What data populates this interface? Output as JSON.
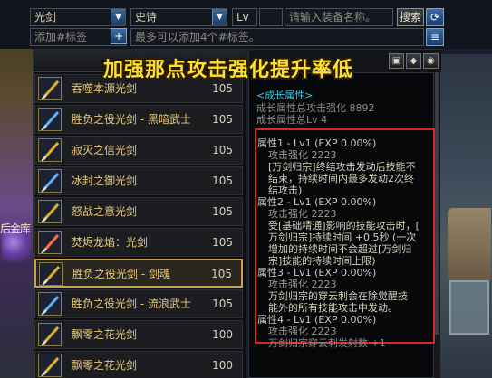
{
  "filters": {
    "weapon_type": "光剑",
    "rarity": "史诗",
    "level_prefix": "Lv",
    "level_value": "",
    "level_value2": "",
    "search_placeholder": "请输入装备名称。",
    "search_label": "搜索",
    "refresh_icon": "refresh-icon",
    "tag_placeholder": "添加#标签",
    "tag_add_label": "+",
    "tag_hint": "最多可以添加4个#标签。",
    "list_icon": "list-icon"
  },
  "banner": "加强那点攻击强化提升率低",
  "items": [
    {
      "name": "吞噬本源光剑",
      "level": "105",
      "selected": false,
      "color": "#e0b030"
    },
    {
      "name": "胜负之役光剑 - 黑暗武士",
      "level": "105",
      "selected": false,
      "color": "#5fb0ff"
    },
    {
      "name": "寂灭之信光剑",
      "level": "105",
      "selected": false,
      "color": "#e0b030"
    },
    {
      "name": "冰封之御光剑",
      "level": "105",
      "selected": false,
      "color": "#5fb0ff"
    },
    {
      "name": "怒战之意光剑",
      "level": "105",
      "selected": false,
      "color": "#e0b030"
    },
    {
      "name": "焚烬龙焰：光剑",
      "level": "105",
      "selected": false,
      "color": "#ff7040"
    },
    {
      "name": "胜负之役光剑 - 剑魂",
      "level": "105",
      "selected": true,
      "color": "#e0b030"
    },
    {
      "name": "胜负之役光剑 - 流浪武士",
      "level": "105",
      "selected": false,
      "color": "#5fb0ff"
    },
    {
      "name": "飘零之花光剑",
      "level": "100",
      "selected": false,
      "color": "#e0b030"
    },
    {
      "name": "飘零之花光剑",
      "level": "100",
      "selected": false,
      "color": "#e0b030"
    }
  ],
  "detail": {
    "growth_title": "<成长属性>",
    "growth_total_atk": "成长属性总攻击强化 8892",
    "growth_total_lv": "成长属性总Lv 4",
    "attrs": [
      {
        "head": "属性1 - Lv1 (EXP 0.00%)",
        "sub": "攻击强化 2223",
        "desc": [
          "[万剑归宗]终结攻击发动后技能不",
          "结束，持续时间内最多发动2次终",
          "结攻击)"
        ]
      },
      {
        "head": "属性2 - Lv1 (EXP 0.00%)",
        "sub": "攻击强化 2223",
        "desc": [
          "受[基础精通]影响的技能攻击时，[",
          "万剑归宗]持续时间 +0.5秒 (一次",
          "增加的持续时间不会超过[万剑归",
          "宗]技能的持续时间上限)"
        ]
      },
      {
        "head": "属性3 - Lv1 (EXP 0.00%)",
        "sub": "攻击强化 2223",
        "desc": [
          "万剑归宗的穿云刺会在除觉醒技",
          "能外的所有技能攻击中发动。"
        ]
      },
      {
        "head": "属性4 - Lv1 (EXP 0.00%)",
        "sub": "攻击强化 2223",
        "desc": [
          "万剑归宗穿云刺发射数 +1"
        ]
      }
    ]
  },
  "detail_toolbar_icons": [
    "compare-icon",
    "pin-icon",
    "eye-icon"
  ],
  "background_sign": "后金库",
  "colors": {
    "accent_gold": "#c9a24a",
    "highlight_red": "#d12828",
    "banner_yellow": "#ffe030",
    "growth_cyan": "#3fc3e0"
  }
}
